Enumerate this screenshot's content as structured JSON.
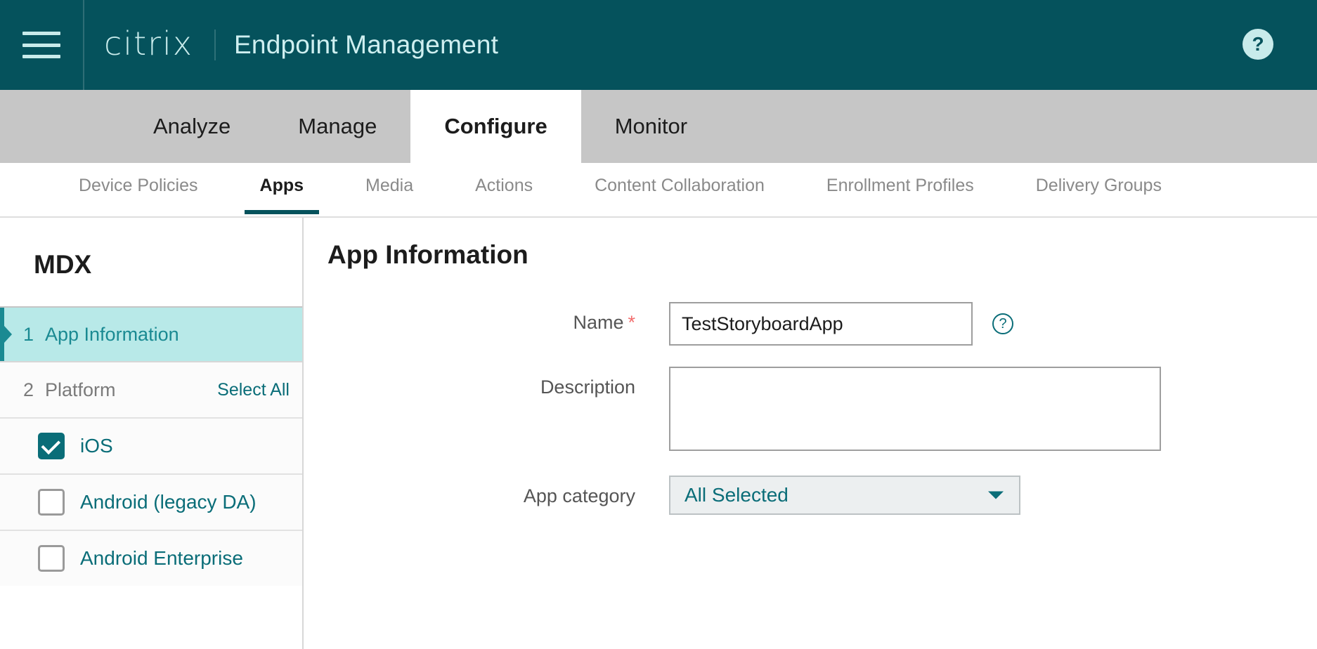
{
  "header": {
    "menu_icon": "hamburger-icon",
    "logo_text": "citrix",
    "title": "Endpoint Management",
    "help_icon": "?",
    "bg_color": "#05525c",
    "text_color": "#cfeff0"
  },
  "primary_tabs": [
    {
      "label": "Analyze",
      "active": false
    },
    {
      "label": "Manage",
      "active": false
    },
    {
      "label": "Configure",
      "active": true
    },
    {
      "label": "Monitor",
      "active": false
    }
  ],
  "sub_tabs": [
    {
      "label": "Device Policies",
      "active": false
    },
    {
      "label": "Apps",
      "active": true
    },
    {
      "label": "Media",
      "active": false
    },
    {
      "label": "Actions",
      "active": false
    },
    {
      "label": "Content Collaboration",
      "active": false
    },
    {
      "label": "Enrollment Profiles",
      "active": false
    },
    {
      "label": "Delivery Groups",
      "active": false
    }
  ],
  "sidebar": {
    "title": "MDX",
    "steps": [
      {
        "num": "1",
        "label": "App Information",
        "active": true
      },
      {
        "num": "2",
        "label": "Platform",
        "active": false,
        "action_label": "Select All"
      }
    ],
    "platforms": [
      {
        "label": "iOS",
        "checked": true
      },
      {
        "label": "Android (legacy DA)",
        "checked": false
      },
      {
        "label": "Android Enterprise",
        "checked": false
      }
    ],
    "accent_color": "#1a8a92",
    "active_bg": "#b8e9e8"
  },
  "main": {
    "title": "App Information",
    "fields": {
      "name": {
        "label": "Name",
        "required_marker": "*",
        "value": "TestStoryboardApp",
        "placeholder": "",
        "help_icon": "?"
      },
      "description": {
        "label": "Description",
        "value": "",
        "placeholder": ""
      },
      "app_category": {
        "label": "App category",
        "selected": "All Selected",
        "caret_icon": "chevron-down-icon"
      }
    }
  }
}
